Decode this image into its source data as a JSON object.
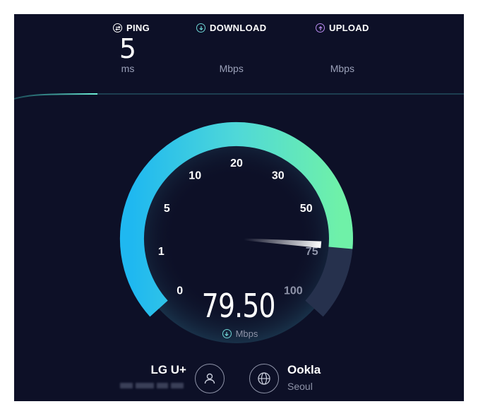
{
  "metrics": {
    "ping": {
      "label": "PING",
      "value": "5",
      "unit": "ms",
      "icon": "ping-icon"
    },
    "download": {
      "label": "DOWNLOAD",
      "value": "",
      "unit": "Mbps",
      "icon": "download-icon"
    },
    "upload": {
      "label": "UPLOAD",
      "value": "",
      "unit": "Mbps",
      "icon": "upload-icon"
    }
  },
  "gauge": {
    "ticks": [
      "0",
      "1",
      "5",
      "10",
      "20",
      "30",
      "50",
      "75",
      "100"
    ],
    "reading": "79.50",
    "unit": "Mbps",
    "needle_fraction": 0.86
  },
  "isp": {
    "name": "LG U+",
    "icon": "user-icon"
  },
  "server": {
    "name": "Ookla",
    "location": "Seoul",
    "icon": "globe-icon"
  },
  "colors": {
    "background": "#0d1027",
    "gauge_start": "#1fb8f0",
    "gauge_end": "#6ff1a8",
    "gauge_track": "#26314d",
    "download_accent": "#6fd6d6",
    "upload_accent": "#b98cf0"
  }
}
